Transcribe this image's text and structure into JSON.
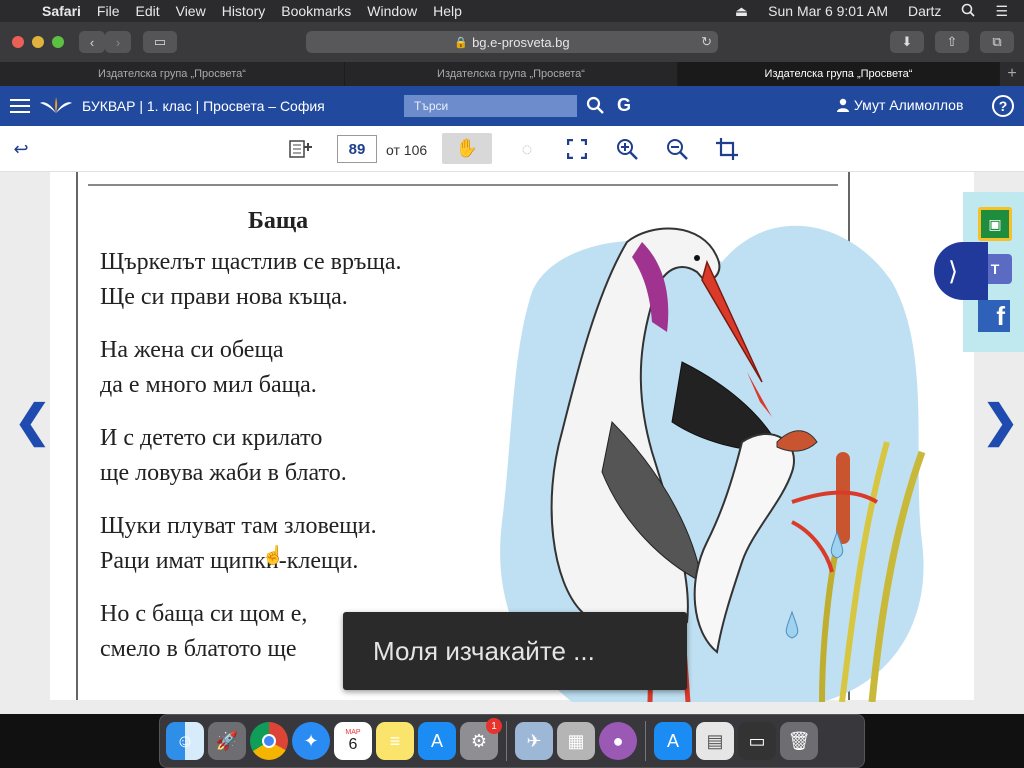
{
  "menubar": {
    "apple": "",
    "app": "Safari",
    "items": [
      "File",
      "Edit",
      "View",
      "History",
      "Bookmarks",
      "Window",
      "Help"
    ],
    "clock": "Sun Mar 6  9:01 AM",
    "user": "Dartz"
  },
  "browser": {
    "url": "bg.e-prosveta.bg",
    "tabs": [
      "Издателска група „Просвета“",
      "Издателска група „Просвета“",
      "Издателска група „Просвета“"
    ]
  },
  "app": {
    "title": "БУКВАР | 1. клас | Просвета – София",
    "search_placeholder": "Търси",
    "user_name": "Умут Алимоллов",
    "help": "?"
  },
  "viewer": {
    "page_number": "89",
    "page_of": "от 106"
  },
  "poem": {
    "title": "Баща",
    "stanzas": [
      [
        "Щъркелът щастлив се връща.",
        "Ще си прави нова къща."
      ],
      [
        "На жена си обеща",
        "да е много мил баща."
      ],
      [
        "И с детето си крилато",
        "ще ловува жаби в блато."
      ],
      [
        "Щуки плуват там зловещи.",
        "Раци имат щипки-клещи."
      ],
      [
        "Но с баща си щом е,",
        "смело в блатото ще"
      ]
    ]
  },
  "toast": {
    "text": "Моля изчакайте ..."
  },
  "dock": {
    "badge_count": "1",
    "calendar_month": "МАР",
    "calendar_day": "6"
  }
}
